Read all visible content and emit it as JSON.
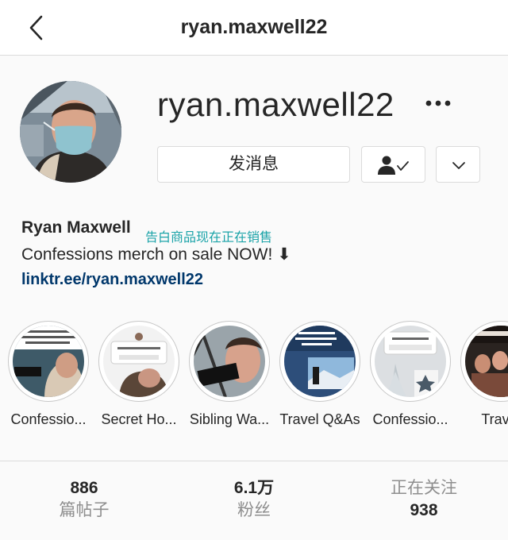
{
  "header": {
    "title": "ryan.maxwell22",
    "back_icon": "chevron-left-icon"
  },
  "profile": {
    "username": "ryan.maxwell22",
    "more_icon": "more-horizontal-icon",
    "message_button_label": "发消息",
    "following_icon": "person-check-icon",
    "dropdown_icon": "chevron-down-icon",
    "full_name": "Ryan Maxwell",
    "translation_note": "告白商品现在正在销售",
    "bio": "Confessions merch on sale NOW! ⬇",
    "link": "linktr.ee/ryan.maxwell22"
  },
  "highlights": [
    {
      "label": "Confessio..."
    },
    {
      "label": "Secret Ho..."
    },
    {
      "label": "Sibling Wa..."
    },
    {
      "label": "Travel Q&As"
    },
    {
      "label": "Confessio..."
    },
    {
      "label": "Travel"
    }
  ],
  "stats": {
    "posts": {
      "value": "886",
      "label": "篇帖子"
    },
    "followers": {
      "value": "6.1万",
      "label": "粉丝"
    },
    "following": {
      "label": "正在关注",
      "value": "938"
    }
  },
  "colors": {
    "link": "#00376b",
    "translation": "#1aa3a8",
    "border": "#dbdbdb",
    "muted": "#8e8e8e"
  }
}
